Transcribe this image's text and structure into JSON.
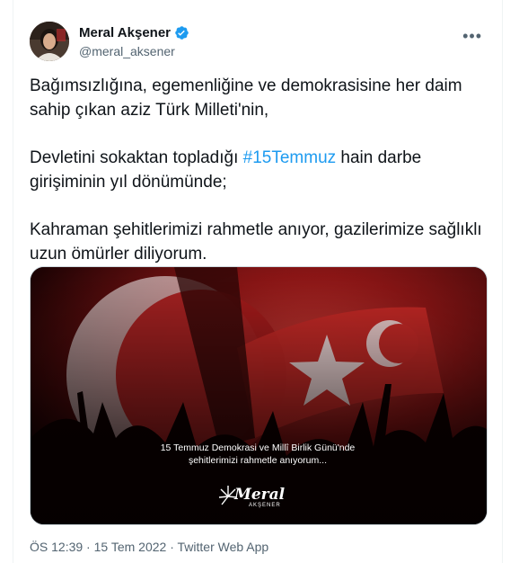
{
  "author": {
    "name": "Meral Akşener",
    "handle": "@meral_aksener",
    "verified_color": "#1d9bf0"
  },
  "more_icon": "ellipsis-icon",
  "tweet": {
    "paragraph1": "Bağımsızlığına, egemenliğine ve demokrasisine her daim sahip çıkan aziz Türk Milleti'nin,",
    "paragraph2_before": "Devletini sokaktan topladığı ",
    "hashtag": "#15Temmuz",
    "paragraph2_after": " hain darbe girişiminin yıl dönümünde;",
    "paragraph3": "Kahraman şehitlerimizi rahmetle anıyor, gazilerimize sağlıklı uzun ömürler diliyorum."
  },
  "media": {
    "caption_line1": "15 Temmuz Demokrasi ve Millî Birlik Günü'nde",
    "caption_line2": "şehitlerimizi rahmetle anıyorum...",
    "logo_text": "Meral",
    "logo_subtext": "AKŞENER"
  },
  "meta": {
    "time": "ÖS 12:39",
    "date": "15 Tem 2022",
    "source": "Twitter Web App",
    "separator": "·"
  }
}
